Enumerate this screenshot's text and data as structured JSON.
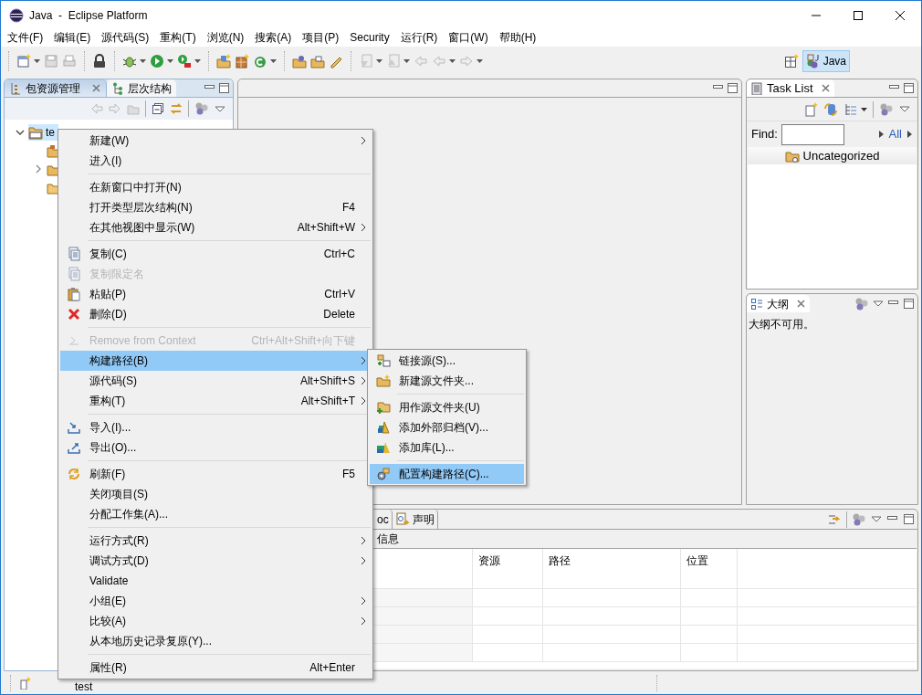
{
  "window": {
    "title": "Java  -  Eclipse Platform"
  },
  "menu_bar": [
    "文件(F)",
    "编辑(E)",
    "源代码(S)",
    "重构(T)",
    "浏览(N)",
    "搜索(A)",
    "项目(P)",
    "Security",
    "运行(R)",
    "窗口(W)",
    "帮助(H)"
  ],
  "perspectives": [
    {
      "label": "Java",
      "selected": true
    }
  ],
  "package_explorer": {
    "tabs": [
      {
        "label": "包资源管理",
        "selected": true
      },
      {
        "label": "层次结构",
        "selected": false
      }
    ],
    "tree": [
      {
        "label": "te",
        "selected": true,
        "expanded": true,
        "children": [
          {
            "kind": "source"
          },
          {
            "kind": "library",
            "expanded": false
          },
          {
            "kind": "folder"
          }
        ]
      }
    ]
  },
  "task_list": {
    "tab": "Task List",
    "find_label": "Find:",
    "all_link": "All",
    "category": "Uncategorized"
  },
  "outline": {
    "tab": "大纲",
    "message": "大纲不可用。"
  },
  "bottom_panel": {
    "tabs": [
      "oc",
      "声明"
    ],
    "summary": "信息",
    "columns": [
      "资源",
      "路径",
      "位置"
    ]
  },
  "status_bar": {
    "text": "test"
  },
  "context_menu": [
    {
      "kind": "item",
      "label": "新建(W)",
      "submenu": true,
      "selected": false,
      "disabled": false
    },
    {
      "kind": "item",
      "label": "进入(I)",
      "selected": false,
      "disabled": false
    },
    {
      "kind": "separator"
    },
    {
      "kind": "item",
      "label": "在新窗口中打开(N)",
      "selected": false,
      "disabled": false
    },
    {
      "kind": "item",
      "label": "打开类型层次结构(N)",
      "shortcut": "F4",
      "selected": false,
      "disabled": false
    },
    {
      "kind": "item",
      "label": "在其他视图中显示(W)",
      "shortcut": "Alt+Shift+W",
      "submenu": true,
      "selected": false,
      "disabled": false
    },
    {
      "kind": "separator"
    },
    {
      "kind": "item",
      "label": "复制(C)",
      "shortcut": "Ctrl+C",
      "selected": false,
      "disabled": false
    },
    {
      "kind": "item",
      "label": "复制限定名",
      "selected": false,
      "disabled": true
    },
    {
      "kind": "item",
      "label": "粘贴(P)",
      "shortcut": "Ctrl+V",
      "selected": false,
      "disabled": false
    },
    {
      "kind": "item",
      "label": "删除(D)",
      "shortcut": "Delete",
      "selected": false,
      "disabled": false
    },
    {
      "kind": "separator"
    },
    {
      "kind": "item",
      "label": "Remove from Context",
      "shortcut": "Ctrl+Alt+Shift+向下键",
      "selected": false,
      "disabled": true
    },
    {
      "kind": "item",
      "label": "构建路径(B)",
      "submenu": true,
      "selected": true,
      "disabled": false
    },
    {
      "kind": "item",
      "label": "源代码(S)",
      "shortcut": "Alt+Shift+S",
      "submenu": true,
      "selected": false,
      "disabled": false
    },
    {
      "kind": "item",
      "label": "重构(T)",
      "shortcut": "Alt+Shift+T",
      "submenu": true,
      "selected": false,
      "disabled": false
    },
    {
      "kind": "separator"
    },
    {
      "kind": "item",
      "label": "导入(I)...",
      "selected": false,
      "disabled": false
    },
    {
      "kind": "item",
      "label": "导出(O)...",
      "selected": false,
      "disabled": false
    },
    {
      "kind": "separator"
    },
    {
      "kind": "item",
      "label": "刷新(F)",
      "shortcut": "F5",
      "selected": false,
      "disabled": false
    },
    {
      "kind": "item",
      "label": "关闭项目(S)",
      "selected": false,
      "disabled": false
    },
    {
      "kind": "item",
      "label": "分配工作集(A)...",
      "selected": false,
      "disabled": false
    },
    {
      "kind": "separator"
    },
    {
      "kind": "item",
      "label": "运行方式(R)",
      "submenu": true,
      "selected": false,
      "disabled": false
    },
    {
      "kind": "item",
      "label": "调试方式(D)",
      "submenu": true,
      "selected": false,
      "disabled": false
    },
    {
      "kind": "item",
      "label": "Validate",
      "selected": false,
      "disabled": false
    },
    {
      "kind": "item",
      "label": "小组(E)",
      "submenu": true,
      "selected": false,
      "disabled": false
    },
    {
      "kind": "item",
      "label": "比较(A)",
      "submenu": true,
      "selected": false,
      "disabled": false
    },
    {
      "kind": "item",
      "label": "从本地历史记录复原(Y)...",
      "selected": false,
      "disabled": false
    },
    {
      "kind": "separator"
    },
    {
      "kind": "item",
      "label": "属性(R)",
      "shortcut": "Alt+Enter",
      "selected": false,
      "disabled": false
    }
  ],
  "submenu": [
    {
      "kind": "item",
      "label": "链接源(S)...",
      "selected": false
    },
    {
      "kind": "item",
      "label": "新建源文件夹...",
      "selected": false
    },
    {
      "kind": "separator"
    },
    {
      "kind": "item",
      "label": "用作源文件夹(U)",
      "selected": false
    },
    {
      "kind": "item",
      "label": "添加外部归档(V)...",
      "selected": false
    },
    {
      "kind": "item",
      "label": "添加库(L)...",
      "selected": false
    },
    {
      "kind": "separator"
    },
    {
      "kind": "item",
      "label": "配置构建路径(C)...",
      "selected": true
    }
  ]
}
